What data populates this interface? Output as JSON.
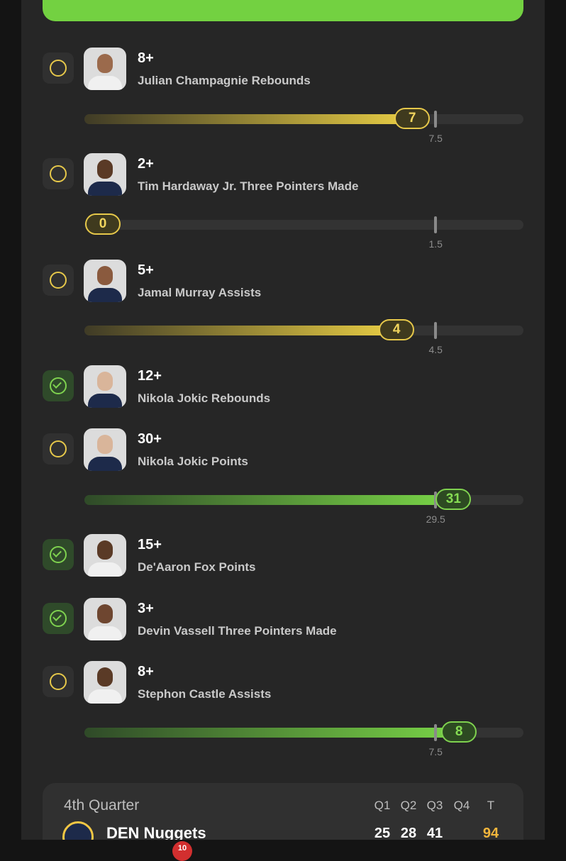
{
  "props": [
    {
      "threshold": "8+",
      "description": "Julian Champagnie Rebounds",
      "status": "pending",
      "progress": {
        "current": "7",
        "line": "7.5",
        "tone": "yellow"
      },
      "avatar": {
        "skin": "#9b6a4c",
        "jersey": "#f0f0f0"
      }
    },
    {
      "threshold": "2+",
      "description": "Tim Hardaway Jr. Three Pointers Made",
      "status": "pending",
      "progress": {
        "current": "0",
        "line": "1.5",
        "tone": "yellow"
      },
      "avatar": {
        "skin": "#5a3a26",
        "jersey": "#1d2a4a"
      }
    },
    {
      "threshold": "5+",
      "description": "Jamal Murray Assists",
      "status": "pending",
      "progress": {
        "current": "4",
        "line": "4.5",
        "tone": "yellow"
      },
      "avatar": {
        "skin": "#8a5a3e",
        "jersey": "#1d2a4a"
      }
    },
    {
      "threshold": "12+",
      "description": "Nikola Jokic Rebounds",
      "status": "hit",
      "progress": null,
      "avatar": {
        "skin": "#d9b59a",
        "jersey": "#1d2a4a"
      }
    },
    {
      "threshold": "30+",
      "description": "Nikola Jokic Points",
      "status": "pending",
      "progress": {
        "current": "31",
        "line": "29.5",
        "tone": "green"
      },
      "avatar": {
        "skin": "#d9b59a",
        "jersey": "#1d2a4a"
      }
    },
    {
      "threshold": "15+",
      "description": "De'Aaron Fox Points",
      "status": "hit",
      "progress": null,
      "avatar": {
        "skin": "#5a3a26",
        "jersey": "#f0f0f0"
      }
    },
    {
      "threshold": "3+",
      "description": "Devin Vassell Three Pointers Made",
      "status": "hit",
      "progress": null,
      "avatar": {
        "skin": "#6e4630",
        "jersey": "#f0f0f0"
      }
    },
    {
      "threshold": "8+",
      "description": "Stephon Castle Assists",
      "status": "pending",
      "progress": {
        "current": "8",
        "line": "7.5",
        "tone": "green"
      },
      "avatar": {
        "skin": "#5a3a26",
        "jersey": "#f0f0f0"
      }
    }
  ],
  "scoreboard": {
    "title": "4th Quarter",
    "columns": [
      "Q1",
      "Q2",
      "Q3",
      "Q4",
      "T"
    ],
    "team": {
      "name": "DEN Nuggets",
      "scores": [
        "25",
        "28",
        "41",
        "",
        "94"
      ]
    }
  },
  "nav": {
    "badge": "10"
  },
  "colors": {
    "accent_green": "#73d141",
    "accent_yellow": "#e6c84a",
    "total_score": "#f2b63c"
  }
}
